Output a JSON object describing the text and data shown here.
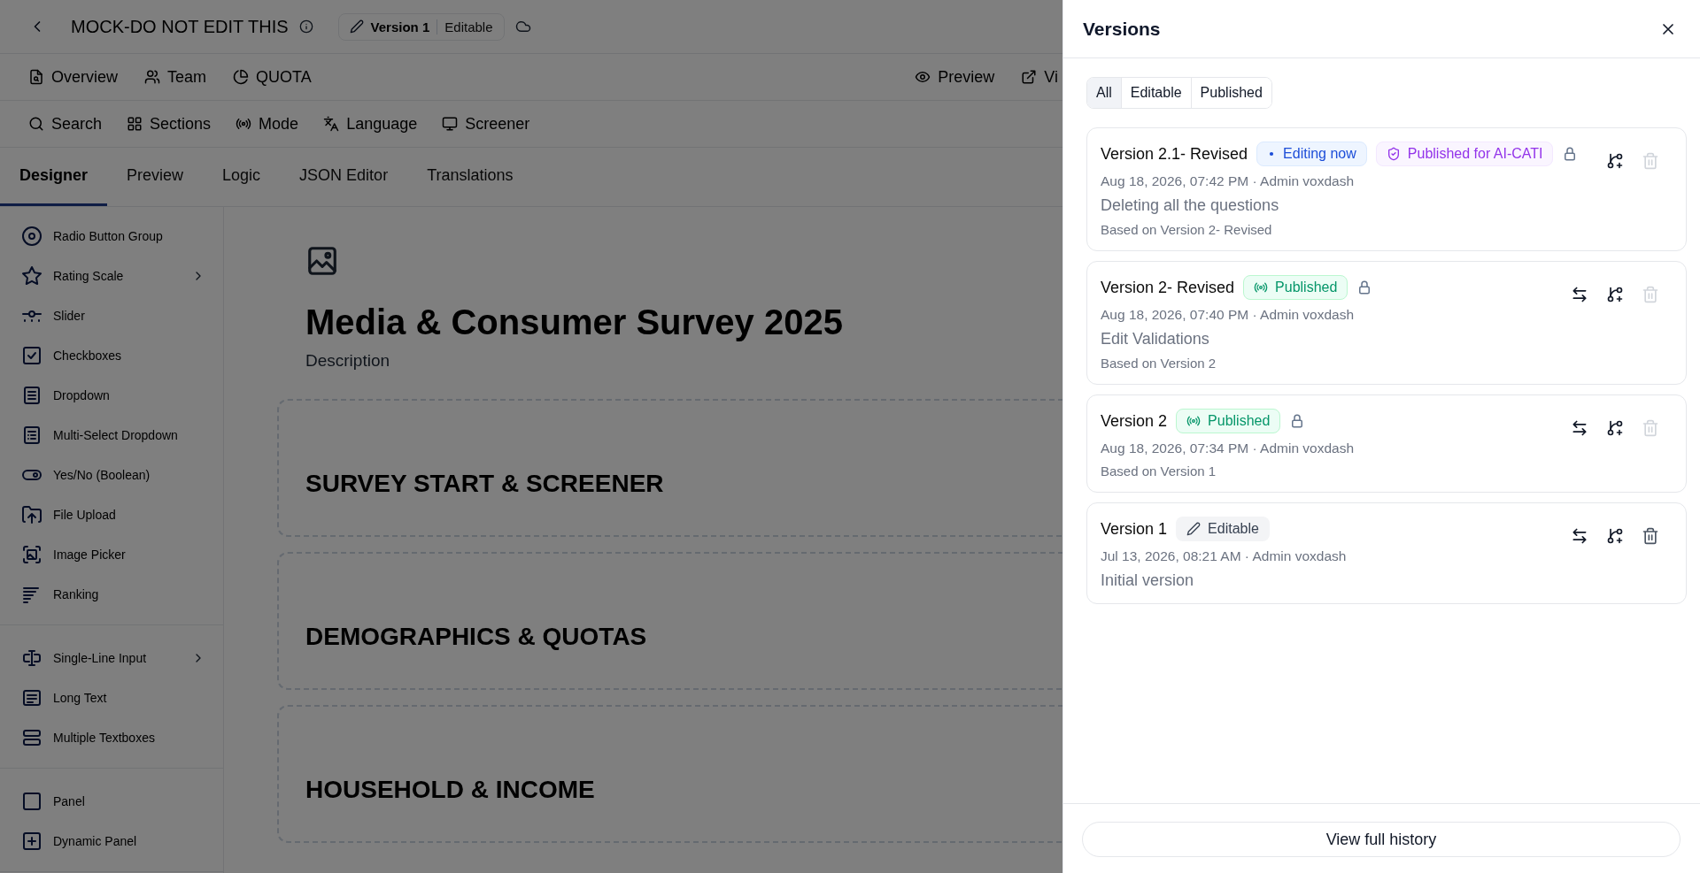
{
  "header": {
    "title": "MOCK-DO NOT EDIT THIS",
    "version_chip": {
      "version": "Version 1",
      "status": "Editable"
    }
  },
  "nav": {
    "left": [
      {
        "label": "Overview",
        "kind": "overview"
      },
      {
        "label": "Team",
        "kind": "team"
      },
      {
        "label": "QUOTA",
        "kind": "quota"
      }
    ],
    "right": [
      {
        "label": "Preview",
        "kind": "preview"
      },
      {
        "label": "Vi",
        "kind": "external"
      }
    ]
  },
  "toolbar": [
    {
      "label": "Search",
      "kind": "search"
    },
    {
      "label": "Sections",
      "kind": "sections"
    },
    {
      "label": "Mode",
      "kind": "mode"
    },
    {
      "label": "Language",
      "kind": "language"
    },
    {
      "label": "Screener",
      "kind": "screener"
    }
  ],
  "tabs": [
    {
      "label": "Designer",
      "selected": true
    },
    {
      "label": "Preview",
      "selected": false
    },
    {
      "label": "Logic",
      "selected": false
    },
    {
      "label": "JSON Editor",
      "selected": false
    },
    {
      "label": "Translations",
      "selected": false
    }
  ],
  "sidebar": {
    "groups": [
      {
        "items": [
          {
            "label": "Radio Button Group",
            "kind": "radio",
            "has_submenu": false
          },
          {
            "label": "Rating Scale",
            "kind": "rating",
            "has_submenu": true
          },
          {
            "label": "Slider",
            "kind": "slider",
            "has_submenu": false
          },
          {
            "label": "Checkboxes",
            "kind": "checkbox",
            "has_submenu": false
          },
          {
            "label": "Dropdown",
            "kind": "dropdown",
            "has_submenu": false
          },
          {
            "label": "Multi-Select Dropdown",
            "kind": "multiselect",
            "has_submenu": false
          },
          {
            "label": "Yes/No (Boolean)",
            "kind": "boolean",
            "has_submenu": false
          },
          {
            "label": "File Upload",
            "kind": "file",
            "has_submenu": false
          },
          {
            "label": "Image Picker",
            "kind": "image",
            "has_submenu": false
          },
          {
            "label": "Ranking",
            "kind": "ranking",
            "has_submenu": false
          }
        ]
      },
      {
        "items": [
          {
            "label": "Single-Line Input",
            "kind": "text",
            "has_submenu": true
          },
          {
            "label": "Long Text",
            "kind": "longtext",
            "has_submenu": false
          },
          {
            "label": "Multiple Textboxes",
            "kind": "multitext",
            "has_submenu": false
          }
        ]
      },
      {
        "items": [
          {
            "label": "Panel",
            "kind": "panel",
            "has_submenu": false
          },
          {
            "label": "Dynamic Panel",
            "kind": "dynamicpanel",
            "has_submenu": false
          }
        ]
      }
    ]
  },
  "survey": {
    "title": "Media & Consumer Survey 2025",
    "description": {
      "placeholder": "Description"
    },
    "sections": [
      {
        "title": "SURVEY START & SCREENER"
      },
      {
        "title": "DEMOGRAPHICS & QUOTAS"
      },
      {
        "title": "HOUSEHOLD & INCOME"
      }
    ]
  },
  "drawer": {
    "title": "Versions",
    "filters": [
      {
        "label": "All",
        "selected": true
      },
      {
        "label": "Editable",
        "selected": false
      },
      {
        "label": "Published",
        "selected": false
      }
    ],
    "versions": [
      {
        "name": "Version 2.1- Revised",
        "badges": [
          {
            "kind": "editing",
            "label": "Editing now"
          },
          {
            "kind": "ai",
            "label": "Published for AI-CATI"
          }
        ],
        "locked": true,
        "meta": "Aug 18, 2026, 07:42 PM · Admin voxdash",
        "note": "Deleting all the questions",
        "based_on": "Based on Version 2- Revised",
        "actions": [
          {
            "kind": "branch",
            "disabled": false
          },
          {
            "kind": "delete",
            "disabled": true
          }
        ]
      },
      {
        "name": "Version 2- Revised",
        "badges": [
          {
            "kind": "published",
            "label": "Published"
          }
        ],
        "locked": true,
        "meta": "Aug 18, 2026, 07:40 PM · Admin voxdash",
        "note": "Edit Validations",
        "based_on": "Based on Version 2",
        "actions": [
          {
            "kind": "compare",
            "disabled": false
          },
          {
            "kind": "branch",
            "disabled": false
          },
          {
            "kind": "delete",
            "disabled": true
          }
        ]
      },
      {
        "name": "Version 2",
        "badges": [
          {
            "kind": "published",
            "label": "Published"
          }
        ],
        "locked": true,
        "meta": "Aug 18, 2026, 07:34 PM · Admin voxdash",
        "based_on": "Based on Version 1",
        "actions": [
          {
            "kind": "compare",
            "disabled": false
          },
          {
            "kind": "branch",
            "disabled": false
          },
          {
            "kind": "delete",
            "disabled": true
          }
        ]
      },
      {
        "name": "Version 1",
        "badges": [
          {
            "kind": "editable",
            "label": "Editable"
          }
        ],
        "locked": false,
        "meta": "Jul 13, 2026, 08:21 AM · Admin voxdash",
        "note": "Initial version",
        "actions": [
          {
            "kind": "compare",
            "disabled": false
          },
          {
            "kind": "branch",
            "disabled": false
          },
          {
            "kind": "delete",
            "disabled": false
          }
        ]
      }
    ],
    "footer_button": "View full history"
  }
}
